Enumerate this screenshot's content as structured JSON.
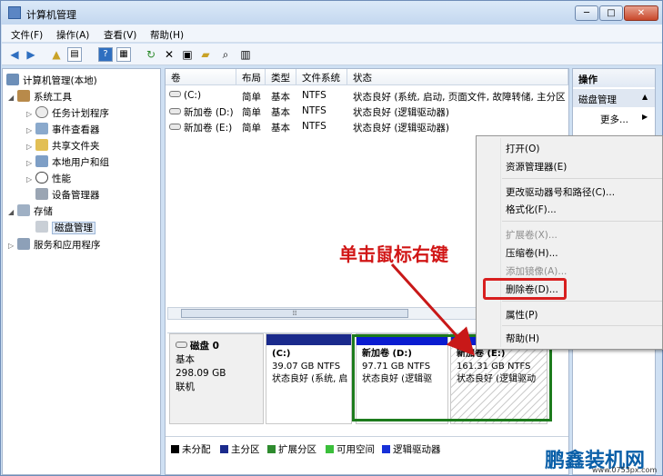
{
  "window": {
    "title": "计算机管理",
    "min": "─",
    "max": "□",
    "close": "✕"
  },
  "menu": [
    "文件(F)",
    "操作(A)",
    "查看(V)",
    "帮助(H)"
  ],
  "toolbar_icons": [
    "back-icon",
    "forward-icon",
    "up-folder-icon",
    "show-tree-icon",
    "help-icon",
    "properties-icon",
    "refresh-icon",
    "delete-icon",
    "properties-sheet-icon",
    "open-folder-icon",
    "search-icon",
    "export-icon"
  ],
  "tree": {
    "root": "计算机管理(本地)",
    "system_tools": "系统工具",
    "task_scheduler": "任务计划程序",
    "event_viewer": "事件查看器",
    "shared_folders": "共享文件夹",
    "local_users": "本地用户和组",
    "performance": "性能",
    "device_manager": "设备管理器",
    "storage": "存储",
    "disk_management": "磁盘管理",
    "services": "服务和应用程序"
  },
  "volumes": {
    "headers": [
      "卷",
      "布局",
      "类型",
      "文件系统",
      "状态"
    ],
    "rows": [
      {
        "name": "(C:)",
        "layout": "简单",
        "type": "基本",
        "fs": "NTFS",
        "status": "状态良好 (系统, 启动, 页面文件, 故障转储, 主分区"
      },
      {
        "name": "新加卷 (D:)",
        "layout": "简单",
        "type": "基本",
        "fs": "NTFS",
        "status": "状态良好 (逻辑驱动器)"
      },
      {
        "name": "新加卷 (E:)",
        "layout": "简单",
        "type": "基本",
        "fs": "NTFS",
        "status": "状态良好 (逻辑驱动器)"
      }
    ]
  },
  "scroll_thumb": "⦙⦙⦙",
  "disk": {
    "name": "磁盘 0",
    "type": "基本",
    "size": "298.09 GB",
    "state": "联机"
  },
  "partitions": [
    {
      "label": "(C:)",
      "size": "39.07 GB NTFS",
      "status": "状态良好 (系统, 启"
    },
    {
      "label": "新加卷 (D:)",
      "size": "97.71 GB NTFS",
      "status": "状态良好 (逻辑驱"
    },
    {
      "label": "新加卷 (E:)",
      "size": "161.31 GB NTFS",
      "status": "状态良好 (逻辑驱动"
    }
  ],
  "legend": [
    {
      "label": "未分配",
      "color": "#000000"
    },
    {
      "label": "主分区",
      "color": "#1a2a8c"
    },
    {
      "label": "扩展分区",
      "color": "#2e8b2e"
    },
    {
      "label": "可用空间",
      "color": "#3bbf3b"
    },
    {
      "label": "逻辑驱动器",
      "color": "#1730d8"
    }
  ],
  "actions": {
    "title": "操作",
    "section": "磁盘管理",
    "more": "更多..."
  },
  "context_menu": [
    {
      "label": "打开(O)",
      "disabled": false
    },
    {
      "label": "资源管理器(E)",
      "disabled": false
    },
    {
      "label": "更改驱动器号和路径(C)...",
      "disabled": false
    },
    {
      "label": "格式化(F)...",
      "disabled": false
    },
    {
      "label": "扩展卷(X)...",
      "disabled": true
    },
    {
      "label": "压缩卷(H)...",
      "disabled": false
    },
    {
      "label": "添加镜像(A)...",
      "disabled": true
    },
    {
      "label": "删除卷(D)...",
      "disabled": false
    },
    {
      "label": "属性(P)",
      "disabled": false
    },
    {
      "label": "帮助(H)",
      "disabled": false
    }
  ],
  "annotation": "单击鼠标右键",
  "watermark": {
    "logo": "鹏鑫装机网",
    "url": "www.0753px.com"
  }
}
